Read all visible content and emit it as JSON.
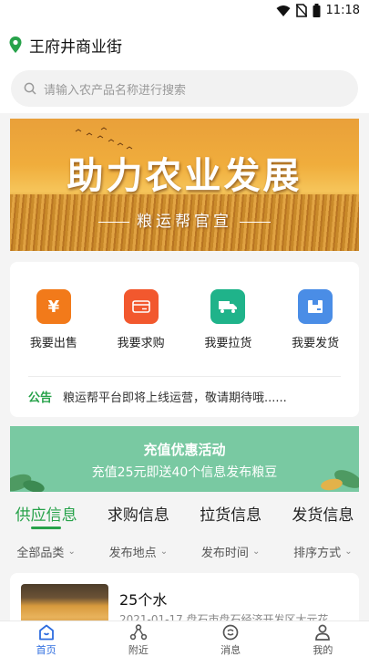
{
  "status_bar": {
    "time": "11:18"
  },
  "location": {
    "name": "王府井商业街"
  },
  "search": {
    "placeholder": "请输入农产品名称进行搜索"
  },
  "banner": {
    "headline": "助力农业发展",
    "subtitle": "粮运帮官宣"
  },
  "actions": [
    {
      "label": "我要出售",
      "icon": "yen-icon",
      "glyph": "¥",
      "color": "#f27a1a"
    },
    {
      "label": "我要求购",
      "icon": "card-icon",
      "glyph": "",
      "color": "#f2582e"
    },
    {
      "label": "我要拉货",
      "icon": "truck-icon",
      "glyph": "",
      "color": "#1fb38a"
    },
    {
      "label": "我要发货",
      "icon": "box-icon",
      "glyph": "",
      "color": "#4a8de6"
    }
  ],
  "notice": {
    "tag": "公告",
    "text": "粮运帮平台即将上线运营，敬请期待哦......"
  },
  "promo": {
    "title": "充值优惠活动",
    "desc": "充值25元即送40个信息发布粮豆"
  },
  "tabs": [
    {
      "label": "供应信息",
      "active": true
    },
    {
      "label": "求购信息",
      "active": false
    },
    {
      "label": "拉货信息",
      "active": false
    },
    {
      "label": "发货信息",
      "active": false
    }
  ],
  "filters": [
    {
      "label": "全部品类"
    },
    {
      "label": "发布地点"
    },
    {
      "label": "发布时间"
    },
    {
      "label": "排序方式"
    }
  ],
  "listing": {
    "title": "25个水",
    "meta": "2021-01-17 盘石市盘石经济开发区大元花"
  },
  "bottom_nav": [
    {
      "label": "首页",
      "icon": "home-icon",
      "active": true
    },
    {
      "label": "附近",
      "icon": "nearby-icon",
      "active": false
    },
    {
      "label": "消息",
      "icon": "message-icon",
      "active": false
    },
    {
      "label": "我的",
      "icon": "profile-icon",
      "active": false
    }
  ],
  "colors": {
    "brand_green": "#27a24a",
    "nav_active": "#2d6cdf",
    "promo_bg": "#79c9a2"
  }
}
